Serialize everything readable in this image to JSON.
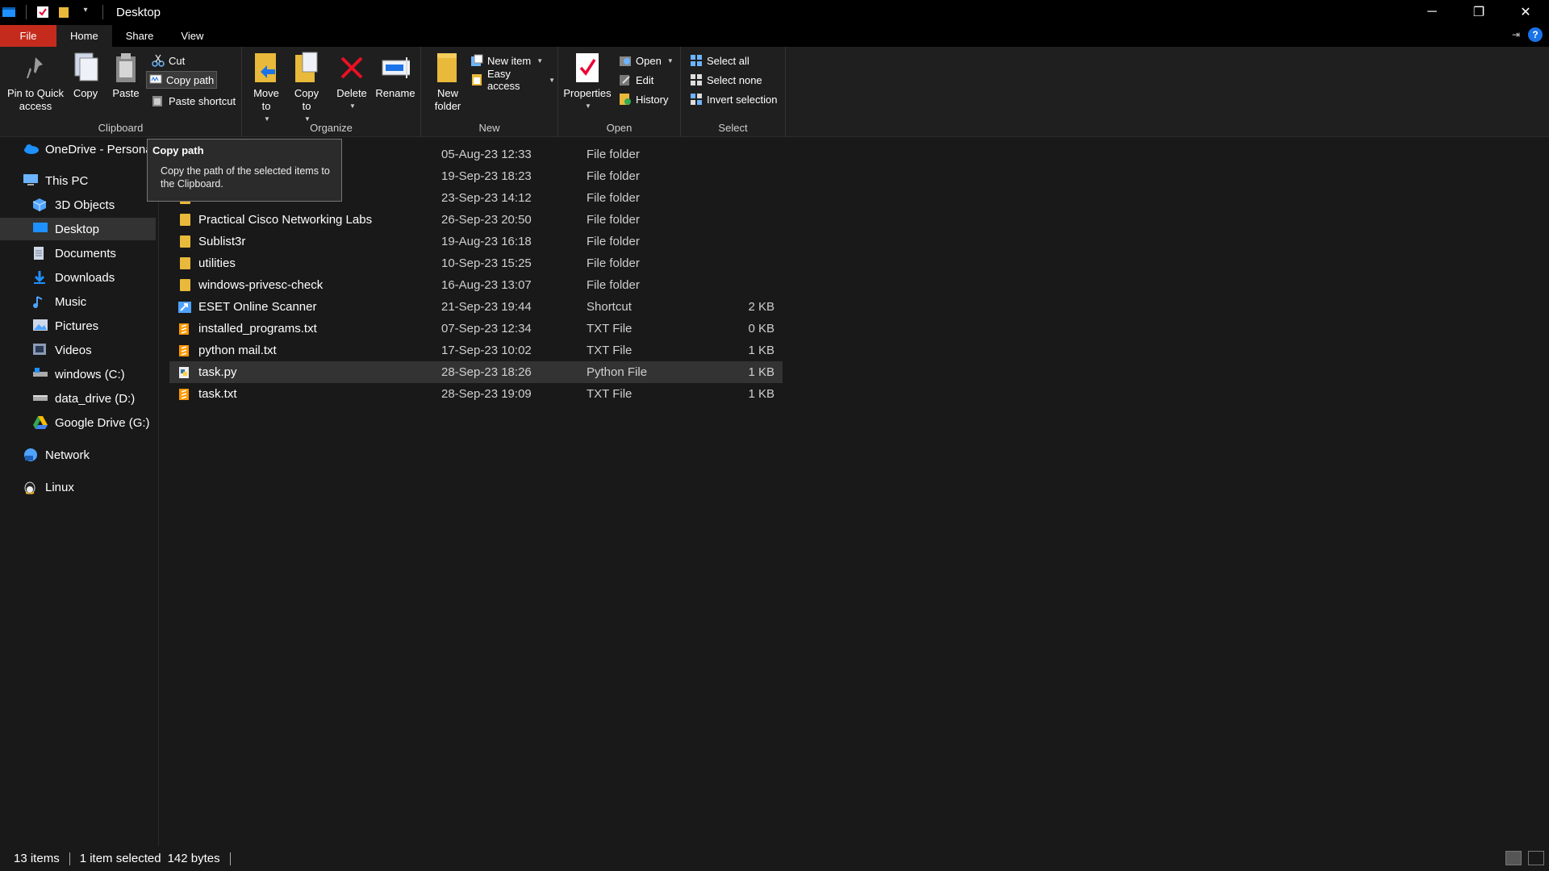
{
  "window": {
    "title": "Desktop",
    "controls": {
      "minimize": "─",
      "restore": "❐",
      "close": "✕"
    }
  },
  "tabs": [
    {
      "label": "File"
    },
    {
      "label": "Home"
    },
    {
      "label": "Share"
    },
    {
      "label": "View"
    }
  ],
  "ribbon": {
    "clipboard": {
      "label": "Clipboard",
      "pin": "Pin to Quick access",
      "copy": "Copy",
      "paste": "Paste",
      "cut": "Cut",
      "copy_path": "Copy path",
      "paste_shortcut": "Paste shortcut"
    },
    "organize": {
      "label": "Organize",
      "move_to": "Move to",
      "copy_to": "Copy to",
      "delete": "Delete",
      "rename": "Rename"
    },
    "new": {
      "label": "New",
      "new_folder": "New folder",
      "new_item": "New item",
      "easy_access": "Easy access"
    },
    "open": {
      "label": "Open",
      "properties": "Properties",
      "open": "Open",
      "edit": "Edit",
      "history": "History"
    },
    "select": {
      "label": "Select",
      "select_all": "Select all",
      "select_none": "Select none",
      "invert_selection": "Invert selection"
    }
  },
  "tooltip": {
    "title": "Copy path",
    "text": "Copy the path of the selected items to the Clipboard."
  },
  "nav": {
    "items": [
      {
        "label": "OneDrive - Persona",
        "icon": "cloud-icon"
      },
      {
        "label": "This PC",
        "icon": "computer-icon"
      },
      {
        "label": "3D Objects",
        "icon": "cube-icon"
      },
      {
        "label": "Desktop",
        "icon": "desktop-icon"
      },
      {
        "label": "Documents",
        "icon": "document-icon"
      },
      {
        "label": "Downloads",
        "icon": "download-icon"
      },
      {
        "label": "Music",
        "icon": "music-icon"
      },
      {
        "label": "Pictures",
        "icon": "pictures-icon"
      },
      {
        "label": "Videos",
        "icon": "video-icon"
      },
      {
        "label": "windows (C:)",
        "icon": "drive-icon"
      },
      {
        "label": "data_drive (D:)",
        "icon": "drive-icon"
      },
      {
        "label": "Google Drive (G:)",
        "icon": "google-drive-icon"
      },
      {
        "label": "Network",
        "icon": "network-icon"
      },
      {
        "label": "Linux",
        "icon": "linux-icon"
      }
    ]
  },
  "files": [
    {
      "name": "",
      "date": "05-Aug-23 12:33",
      "type": "File folder",
      "size": "",
      "icon": "folder-icon"
    },
    {
      "name": "",
      "date": "19-Sep-23 18:23",
      "type": "File folder",
      "size": "",
      "icon": "folder-icon"
    },
    {
      "name": "",
      "date": "23-Sep-23 14:12",
      "type": "File folder",
      "size": "",
      "icon": "folder-icon"
    },
    {
      "name": "Practical Cisco Networking Labs",
      "date": "26-Sep-23 20:50",
      "type": "File folder",
      "size": "",
      "icon": "folder-icon"
    },
    {
      "name": "Sublist3r",
      "date": "19-Aug-23 16:18",
      "type": "File folder",
      "size": "",
      "icon": "folder-icon"
    },
    {
      "name": "utilities",
      "date": "10-Sep-23 15:25",
      "type": "File folder",
      "size": "",
      "icon": "folder-icon"
    },
    {
      "name": "windows-privesc-check",
      "date": "16-Aug-23 13:07",
      "type": "File folder",
      "size": "",
      "icon": "folder-icon"
    },
    {
      "name": "ESET Online Scanner",
      "date": "21-Sep-23 19:44",
      "type": "Shortcut",
      "size": "2 KB",
      "icon": "shortcut-icon"
    },
    {
      "name": "installed_programs.txt",
      "date": "07-Sep-23 12:34",
      "type": "TXT File",
      "size": "0 KB",
      "icon": "sublime-file-icon"
    },
    {
      "name": "python mail.txt",
      "date": "17-Sep-23 10:02",
      "type": "TXT File",
      "size": "1 KB",
      "icon": "sublime-file-icon"
    },
    {
      "name": "task.py",
      "date": "28-Sep-23 18:26",
      "type": "Python File",
      "size": "1 KB",
      "icon": "python-file-icon"
    },
    {
      "name": "task.txt",
      "date": "28-Sep-23 19:09",
      "type": "TXT File",
      "size": "1 KB",
      "icon": "sublime-file-icon"
    }
  ],
  "status": {
    "items": "13 items",
    "selected": "1 item selected",
    "size": "142 bytes"
  },
  "colors": {
    "file_tab": "#c42b1c",
    "folder": "#e8b93a",
    "accent_blue": "#1a73e8",
    "delete_red": "#e81123"
  }
}
